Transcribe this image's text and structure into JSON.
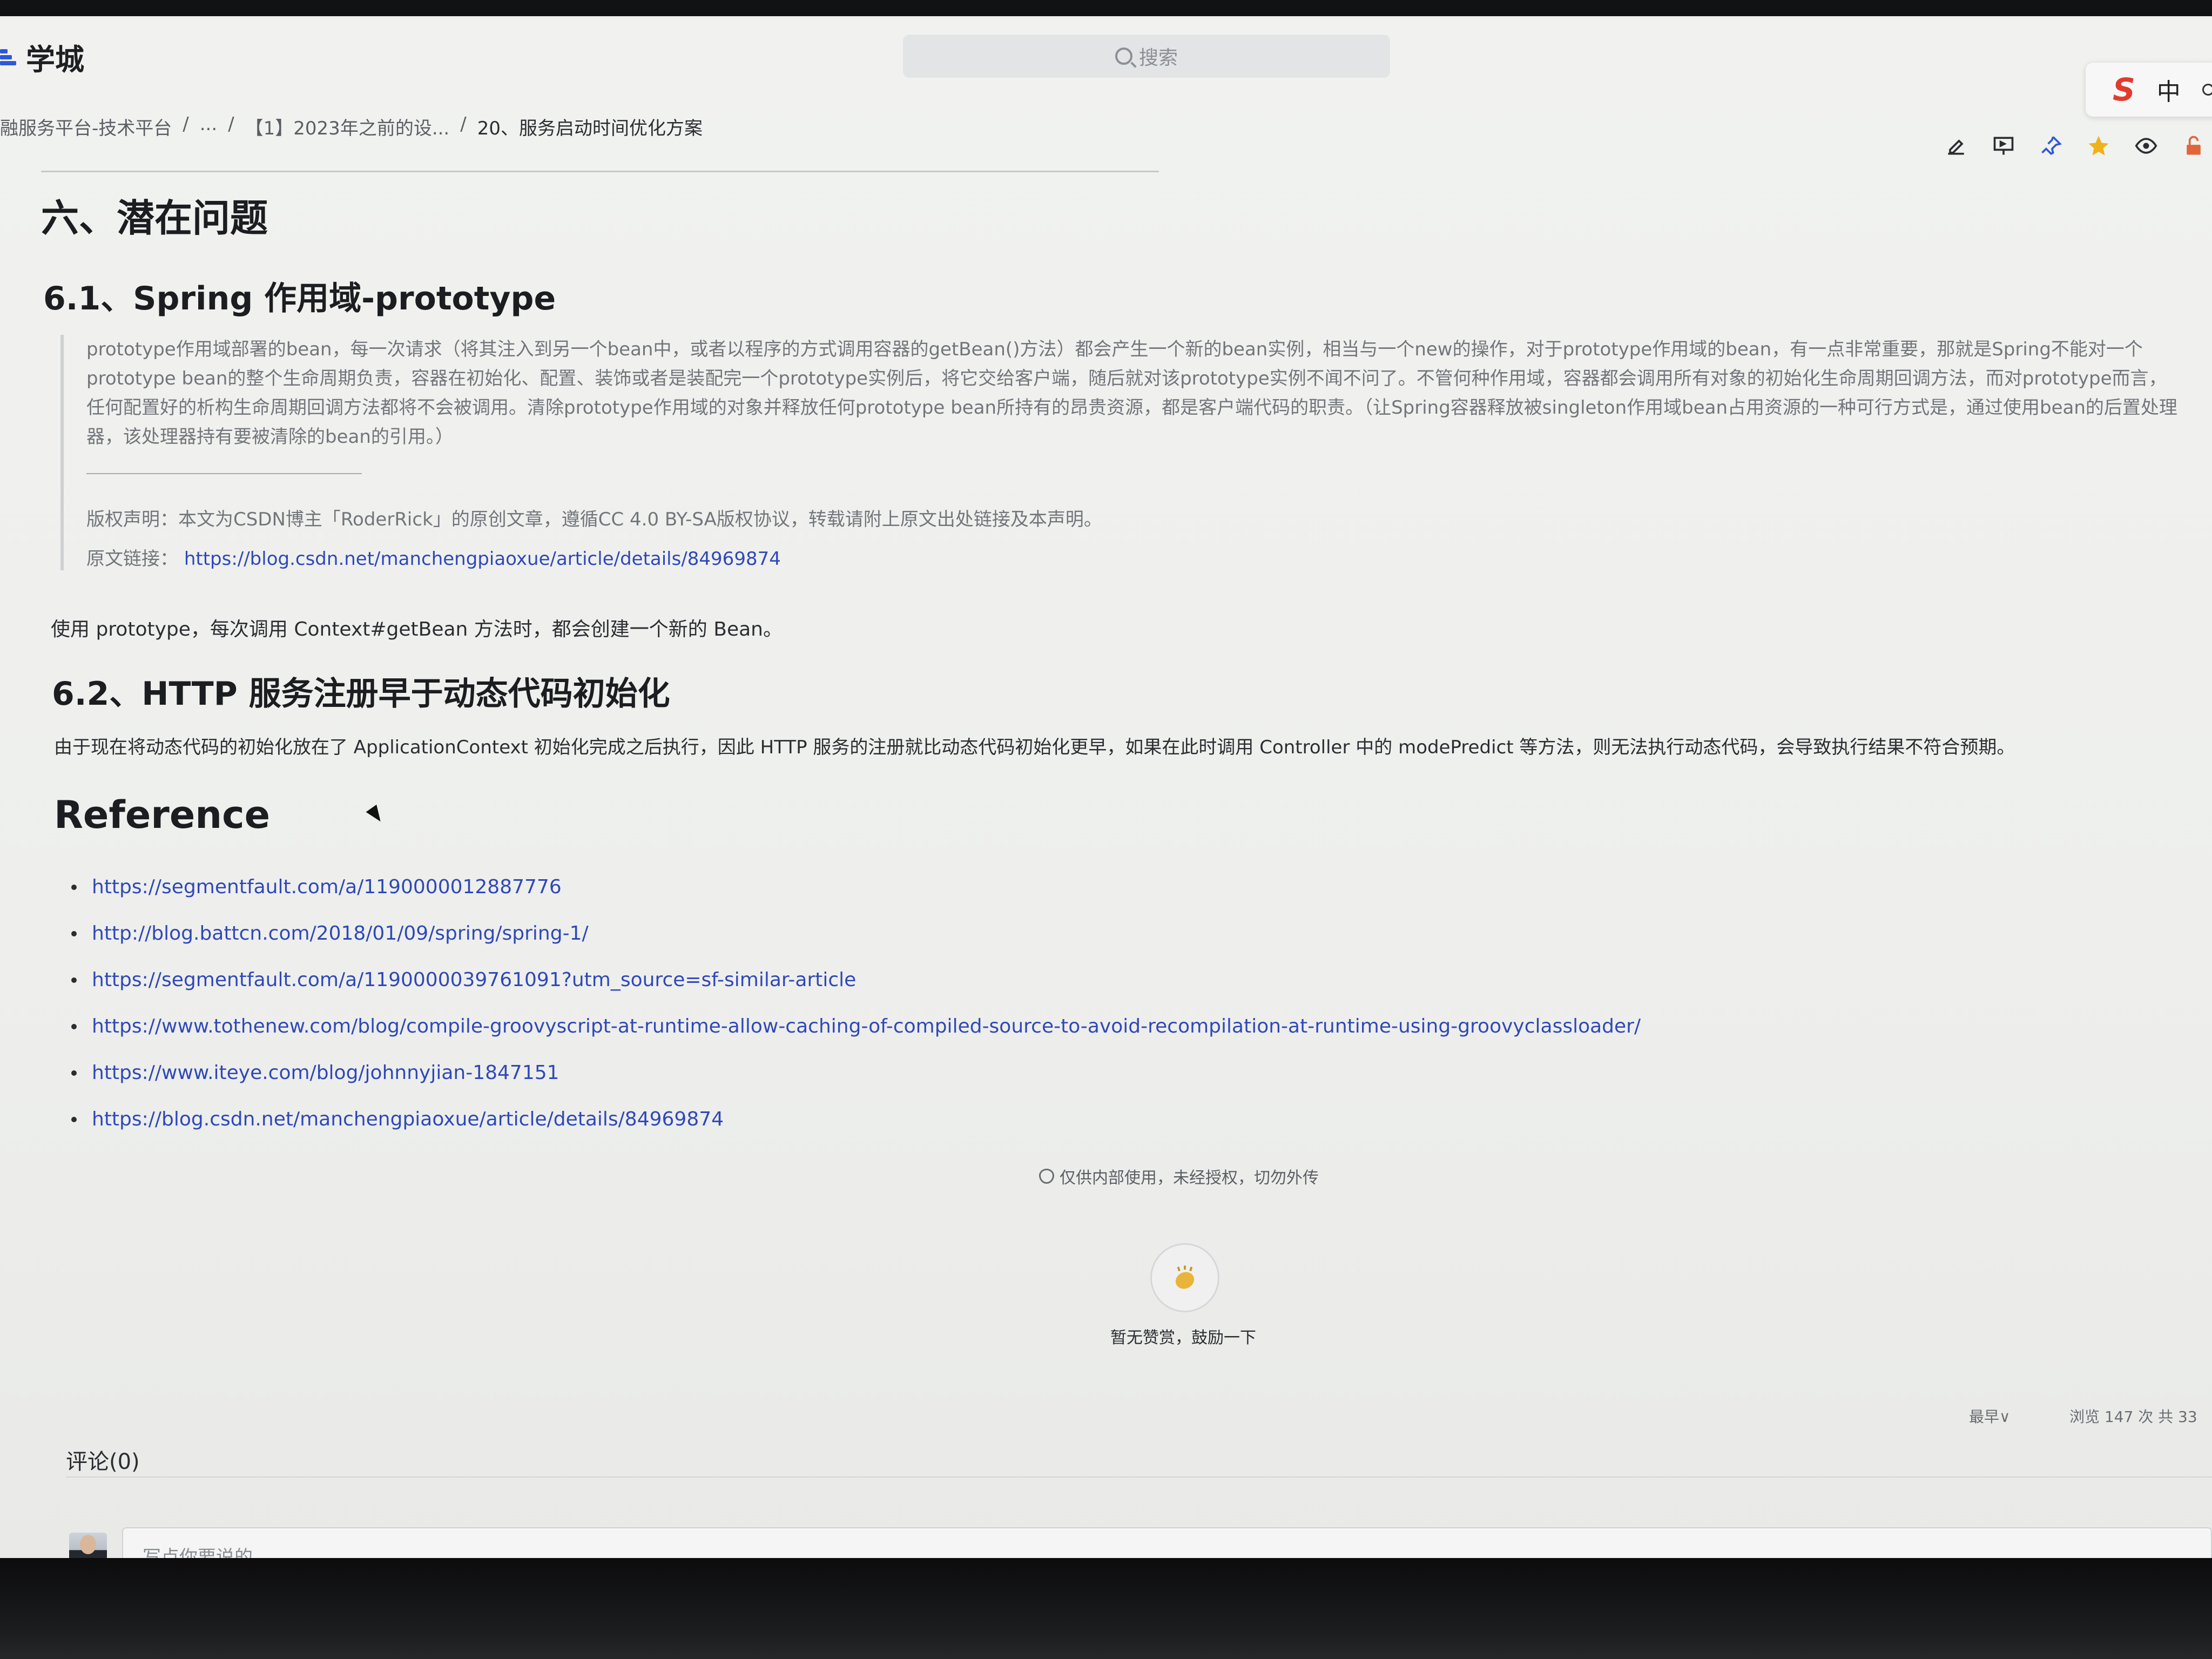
{
  "app": {
    "title": "学城"
  },
  "search": {
    "placeholder": "搜索"
  },
  "ime": {
    "logo": "S",
    "mode": "中"
  },
  "breadcrumb": {
    "items": [
      "融服务平台-技术平台",
      "...",
      "【1】2023年之前的设...",
      "20、服务启动时间优化方案"
    ],
    "separator": "/"
  },
  "toolbar": {
    "icons": [
      "edit-icon",
      "present-icon",
      "pin-icon",
      "star-icon",
      "eye-icon",
      "lock-icon"
    ]
  },
  "content": {
    "h1": "六、潜在问题",
    "section1": {
      "heading": "6.1、Spring 作用域-prototype",
      "quote_lines": [
        "prototype作用域部署的bean，每一次请求（将其注入到另一个bean中，或者以程序的方式调用容器的getBean()方法）都会产生一个新的bean实例，相当与一个new的操作，对于prototype作用域的bean，有一点非常重要，那就是Spring不能对一个",
        "prototype bean的整个生命周期负责，容器在初始化、配置、装饰或者是装配完一个prototype实例后，将它交给客户端，随后就对该prototype实例不闻不问了。不管何种作用域，容器都会调用所有对象的初始化生命周期回调方法，而对prototype而言，",
        "任何配置好的析构生命周期回调方法都将不会被调用。清除prototype作用域的对象并释放任何prototype bean所持有的昂贵资源，都是客户端代码的职责。（让Spring容器释放被singleton作用域bean占用资源的一种可行方式是，通过使用bean的后置处理",
        "器，该处理器持有要被清除的bean的引用。）"
      ],
      "copyright": "版权声明：本文为CSDN博主「RoderRick」的原创文章，遵循CC 4.0 BY-SA版权协议，转载请附上原文出处链接及本声明。",
      "origin_label": "原文链接：",
      "origin_url": "https://blog.csdn.net/manchengpiaoxue/article/details/84969874",
      "usage": "使用 prototype，每次调用 Context#getBean 方法时，都会创建一个新的 Bean。"
    },
    "section2": {
      "heading": "6.2、HTTP 服务注册早于动态代码初始化",
      "paragraph": "由于现在将动态代码的初始化放在了 ApplicationContext 初始化完成之后执行，因此 HTTP 服务的注册就比动态代码初始化更早，如果在此时调用 Controller 中的 modePredict 等方法，则无法执行动态代码，会导致执行结果不符合预期。"
    },
    "reference": {
      "heading": "Reference",
      "links": [
        "https://segmentfault.com/a/1190000012887776",
        "http://blog.battcn.com/2018/01/09/spring/spring-1/",
        "https://segmentfault.com/a/1190000039761091?utm_source=sf-similar-article",
        "https://www.tothenew.com/blog/compile-groovyscript-at-runtime-allow-caching-of-compiled-source-to-avoid-recompilation-at-runtime-using-groovyclassloader/",
        "https://www.iteye.com/blog/johnnyjian-1847151",
        "https://blog.csdn.net/manchengpiaoxue/article/details/84969874"
      ]
    }
  },
  "footer": {
    "notice": "仅供内部使用，未经授权，切勿外传",
    "clap_text": "暂无赞赏，鼓励一下",
    "sort_label": "最早∨",
    "views_text": "浏览 147 次 共 33",
    "comments_title": "评论(0)",
    "comment_placeholder": "写点你要说的"
  },
  "colors": {
    "link": "#2f48b8",
    "brand": "#2f58d8",
    "ime_logo": "#e23b2e"
  }
}
